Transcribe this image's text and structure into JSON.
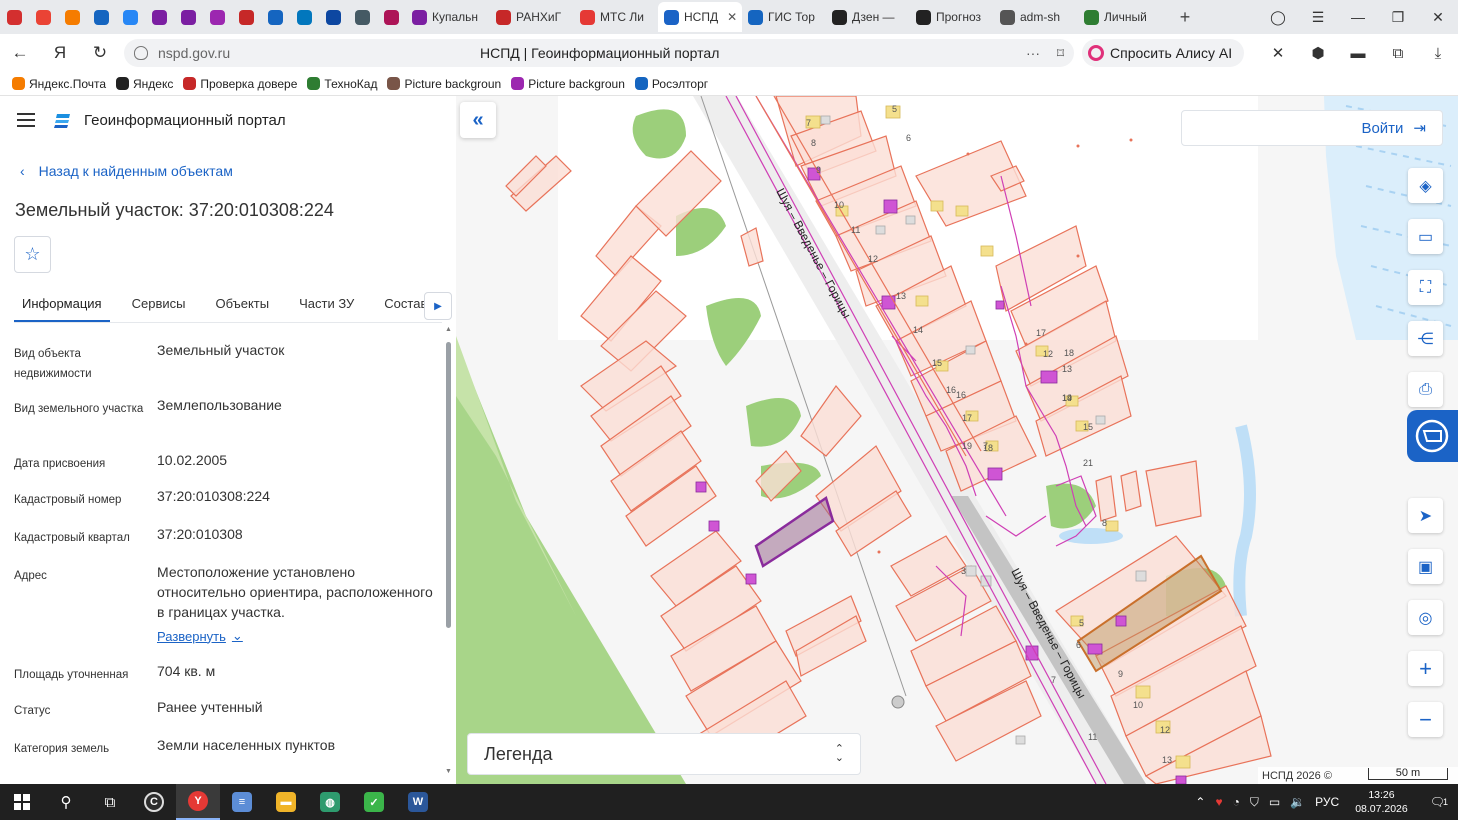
{
  "browser": {
    "tabs": [
      {
        "label": "",
        "icon": "yandex-browser-icon",
        "color": "#d32f2f"
      },
      {
        "label": "",
        "icon": "gmail-icon",
        "color": "#ea4335"
      },
      {
        "label": "",
        "icon": "mail-icon",
        "color": "#f57c00"
      },
      {
        "label": "",
        "icon": "flag-icon",
        "color": "#1565c0"
      },
      {
        "label": "",
        "icon": "vk-icon",
        "color": "#2787f5"
      },
      {
        "label": "",
        "icon": "app-icon",
        "color": "#7b1fa2"
      },
      {
        "label": "",
        "icon": "app-icon",
        "color": "#7b1fa2"
      },
      {
        "label": "",
        "icon": "wb-icon",
        "color": "#9c27b0"
      },
      {
        "label": "",
        "icon": "emblem-icon",
        "color": "#c62828"
      },
      {
        "label": "",
        "icon": "app-icon",
        "color": "#1565c0"
      },
      {
        "label": "",
        "icon": "app-icon",
        "color": "#0277bd"
      },
      {
        "label": "",
        "icon": "app-icon",
        "color": "#0d47a1"
      },
      {
        "label": "",
        "icon": "app-icon",
        "color": "#455a64"
      },
      {
        "label": "",
        "icon": "app-icon",
        "color": "#ad1457"
      },
      {
        "label": "Купальн",
        "icon": "app-icon",
        "color": "#7b1fa2"
      },
      {
        "label": "РАНХиГ",
        "icon": "emblem-icon",
        "color": "#c62828"
      },
      {
        "label": "МТС Ли",
        "icon": "app-icon",
        "color": "#e53935"
      },
      {
        "label": "НСПД",
        "icon": "nspd-icon",
        "color": "#1b63c6"
      },
      {
        "label": "ГИС Тор",
        "icon": "emblem-icon",
        "color": "#1565c0"
      },
      {
        "label": "Дзен —",
        "icon": "plus-icon",
        "color": "#222222"
      },
      {
        "label": "Прогноз",
        "icon": "plus-icon",
        "color": "#222222"
      },
      {
        "label": "adm-sh",
        "icon": "document-icon",
        "color": "#555555"
      },
      {
        "label": "Личный",
        "icon": "emblem-icon",
        "color": "#2e7d32"
      }
    ],
    "active_tab_index": 17,
    "url": "nspd.gov.ru",
    "page_title": "НСПД | Геоинформационный портал",
    "alice_label": "Спросить Алису AI",
    "bookmarks": [
      {
        "label": "Яндекс.Почта",
        "icon": "mail-icon",
        "color": "#f57c00"
      },
      {
        "label": "Яндекс",
        "icon": "plus-icon",
        "color": "#222222"
      },
      {
        "label": "Проверка довере",
        "icon": "emblem-icon",
        "color": "#c62828"
      },
      {
        "label": "ТехноКад",
        "icon": "m-icon",
        "color": "#2e7d32"
      },
      {
        "label": "Picture backgroun",
        "icon": "image-icon",
        "color": "#795548"
      },
      {
        "label": "Picture backgroun",
        "icon": "image-icon",
        "color": "#9c27b0"
      },
      {
        "label": "Росэлторг",
        "icon": "globe-icon",
        "color": "#1565c0"
      }
    ]
  },
  "app": {
    "name": "Геоинформационный портал",
    "back_label": "Назад к найденным объектам",
    "object_title": "Земельный участок: 37:20:010308:224",
    "tabs": [
      "Информация",
      "Сервисы",
      "Объекты",
      "Части ЗУ",
      "Состав"
    ],
    "active_tab": "Информация",
    "properties": [
      {
        "label": "Вид объекта недвижимости",
        "value": "Земельный участок"
      },
      {
        "label": "Вид земельного участка",
        "value": "Землепользование"
      },
      {
        "label": "Дата присвоения",
        "value": "10.02.2005"
      },
      {
        "label": "Кадастровый номер",
        "value": "37:20:010308:224"
      },
      {
        "label": "Кадастровый квартал",
        "value": "37:20:010308"
      },
      {
        "label": "Адрес",
        "value": "Местоположение установлено относительно ориентира, расположенного в границах участка."
      },
      {
        "label": "Площадь уточненная",
        "value": "704 кв. м"
      },
      {
        "label": "Статус",
        "value": "Ранее учтенный"
      },
      {
        "label": "Категория земель",
        "value": "Земли населенных пунктов"
      }
    ],
    "expand_label": "Развернуть"
  },
  "map": {
    "login_label": "Войти",
    "legend_label": "Легенда",
    "attribution": "НСПД 2026 ©",
    "scale_label": "50 m",
    "road_label": "Шуя – Введенье – Горицы",
    "parcel_numbers": [
      "5",
      "6",
      "7",
      "8",
      "9",
      "10",
      "11",
      "12",
      "13",
      "14",
      "15",
      "16",
      "17",
      "18",
      "19",
      "21",
      "12",
      "13",
      "14",
      "15",
      "16",
      "17",
      "18",
      "19",
      "7",
      "8",
      "3",
      "5",
      "6",
      "7",
      "9",
      "10",
      "11",
      "12",
      "13"
    ],
    "tools": [
      "layers-icon",
      "ruler-icon",
      "select-area-icon",
      "share-icon",
      "print-icon",
      "assistant-icon",
      "locate-icon",
      "minimap-icon",
      "pin-icon",
      "zoom-in-icon",
      "zoom-out-icon"
    ],
    "colors": {
      "parcel_fill": "#fbded6",
      "parcel_stroke": "#e8735a",
      "green": "#a5cc7a",
      "water": "#bfdff7",
      "road": "#c9c9c9",
      "utility": "#cf3fb5",
      "accent": "#1b63c6",
      "selected": "#8a2c9c"
    }
  },
  "taskbar": {
    "apps": [
      "start-icon",
      "search-icon",
      "taskview-icon",
      "app-icon",
      "yandex-browser-icon",
      "notepad-icon",
      "folder-icon",
      "app-icon",
      "app-icon",
      "word-icon"
    ],
    "language": "РУС",
    "time": "13:26",
    "date": "08.07.2026",
    "notifications": "1"
  }
}
